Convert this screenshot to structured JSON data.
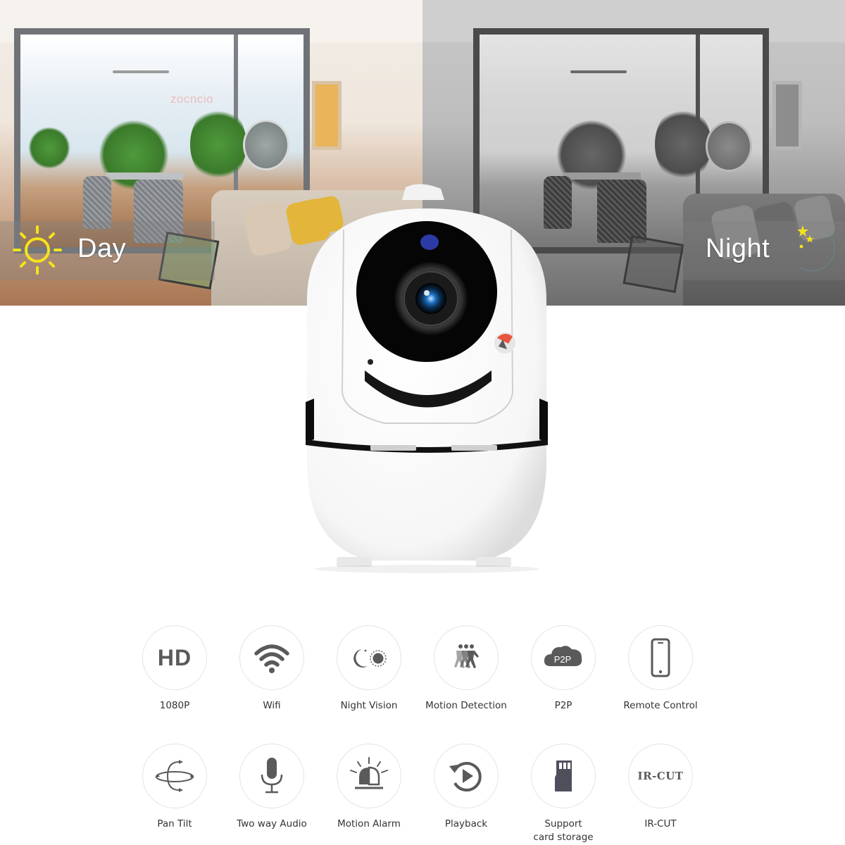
{
  "panels": {
    "day": {
      "label": "Day",
      "icon": "sun-icon",
      "accent": "#f5e31a"
    },
    "night": {
      "label": "Night",
      "icon": "moon-icon",
      "accent": "#d6f3fb",
      "star_color": "#f5e31a"
    }
  },
  "watermark": "zocncio",
  "product": {
    "name": "camera",
    "lens_color": "#1a6fc0",
    "body_color": "#ffffff"
  },
  "features": {
    "row1": [
      {
        "id": "hd",
        "icon": "hd-icon",
        "icon_text": "HD",
        "label": "1080P"
      },
      {
        "id": "wifi",
        "icon": "wifi-icon",
        "label": "Wifi"
      },
      {
        "id": "night-vision",
        "icon": "moon-sun-icon",
        "label": "Night Vision"
      },
      {
        "id": "motion-detection",
        "icon": "running-people-icon",
        "label": "Motion Detection"
      },
      {
        "id": "p2p",
        "icon": "p2p-cloud-icon",
        "icon_text": "P2P",
        "label": "P2P"
      },
      {
        "id": "remote-control",
        "icon": "smartphone-icon",
        "label": "Remote Control"
      }
    ],
    "row2": [
      {
        "id": "pan-tilt",
        "icon": "pan-tilt-icon",
        "label": "Pan Tilt"
      },
      {
        "id": "two-way-audio",
        "icon": "microphone-icon",
        "label": "Two way Audio"
      },
      {
        "id": "motion-alarm",
        "icon": "siren-icon",
        "label": "Motion Alarm"
      },
      {
        "id": "playback",
        "icon": "replay-icon",
        "label": "Playback"
      },
      {
        "id": "card-storage",
        "icon": "sd-card-icon",
        "label_line1": "Support",
        "label_line2": "card storage"
      },
      {
        "id": "ir-cut",
        "icon": "ir-cut-icon",
        "icon_text": "IR-CUT",
        "label": "IR-CUT"
      }
    ],
    "icon_color": "#5a5a5a"
  }
}
